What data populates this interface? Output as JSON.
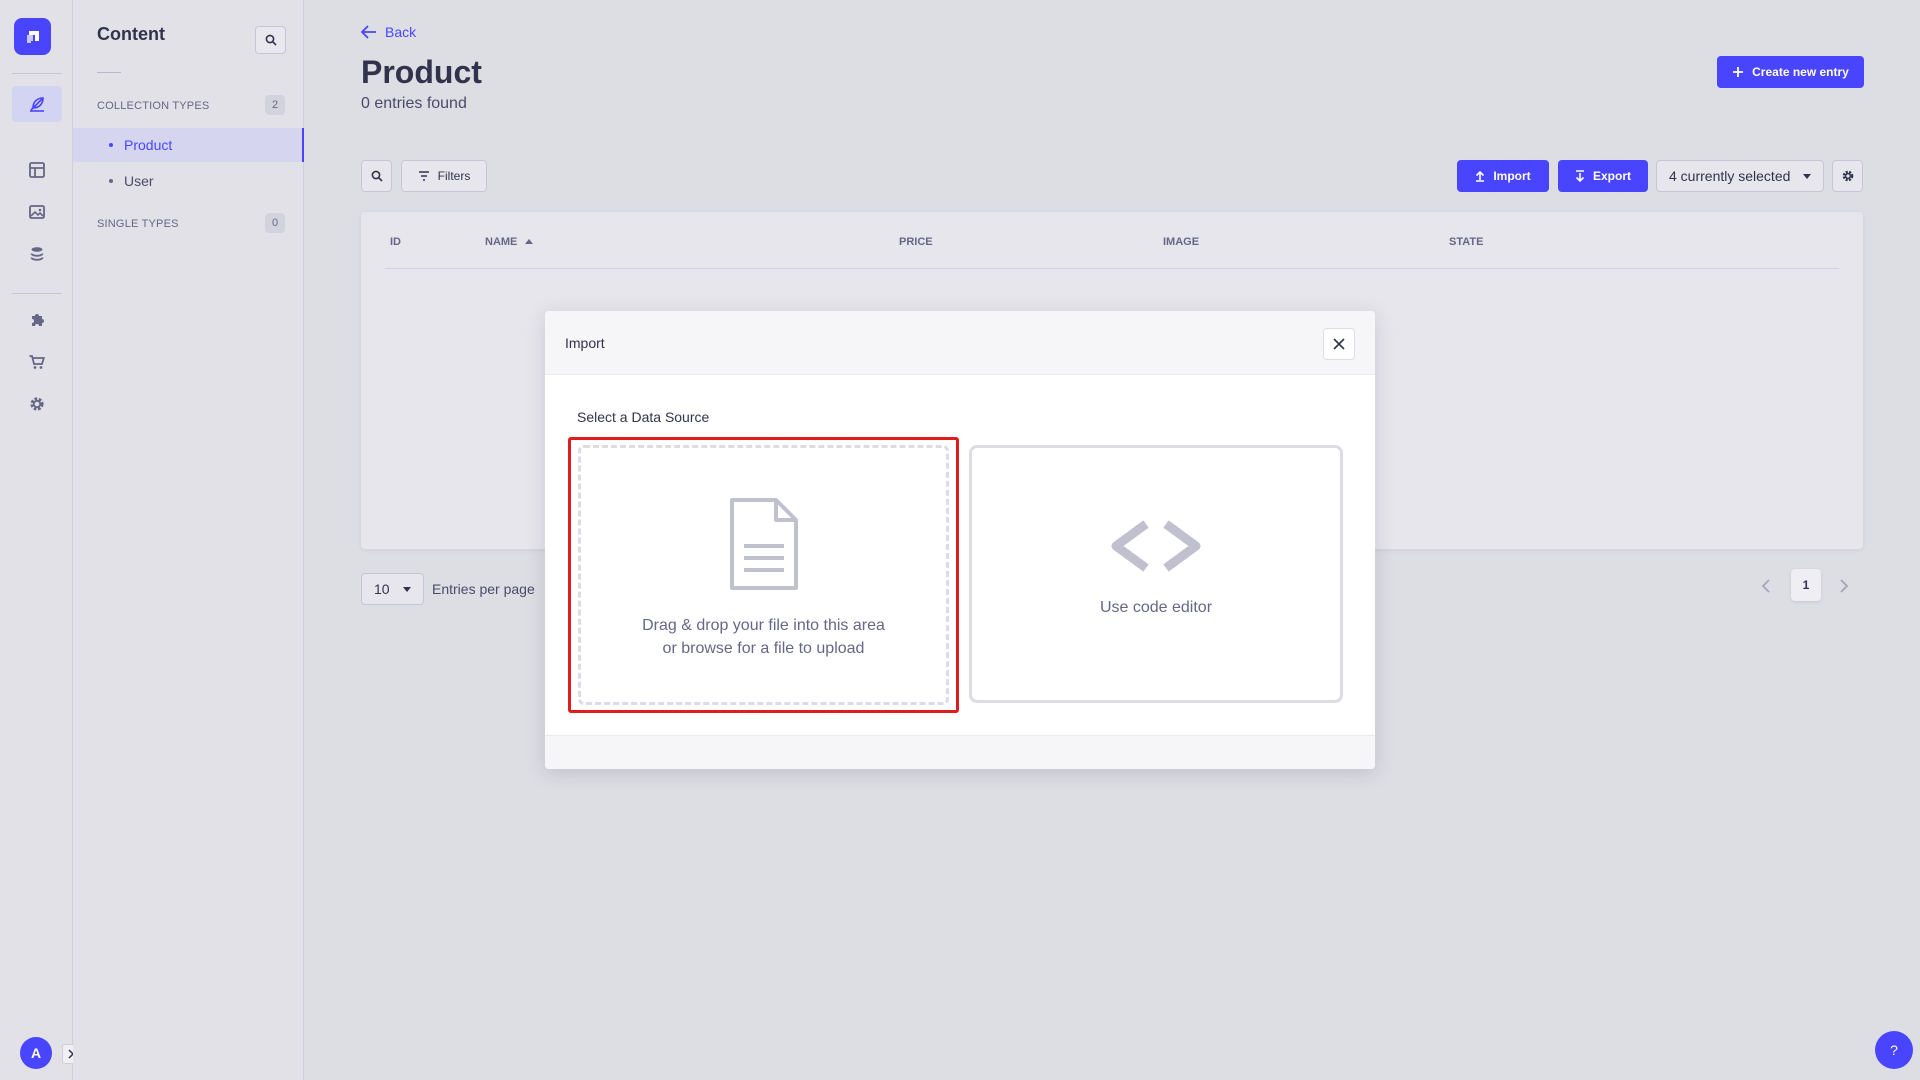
{
  "sidebar": {
    "title": "Content",
    "collection_types_label": "COLLECTION TYPES",
    "collection_types_count": "2",
    "single_types_label": "SINGLE TYPES",
    "single_types_count": "0",
    "items": [
      {
        "label": "Product",
        "active": true
      },
      {
        "label": "User",
        "active": false
      }
    ],
    "avatar_initial": "A"
  },
  "header": {
    "back_label": "Back",
    "title": "Product",
    "subtitle": "0 entries found",
    "create_label": "Create new entry"
  },
  "toolbar": {
    "filters_label": "Filters",
    "import_label": "Import",
    "export_label": "Export",
    "columns_select": "4 currently selected"
  },
  "table": {
    "columns": [
      "ID",
      "NAME",
      "PRICE",
      "IMAGE",
      "STATE"
    ]
  },
  "pagination": {
    "per_page": "10",
    "per_page_label": "Entries per page",
    "current_page": "1"
  },
  "help_label": "?",
  "modal": {
    "title": "Import",
    "section_label": "Select a Data Source",
    "dropzone_line1": "Drag & drop your file into this area",
    "dropzone_line2": "or browse for a file to upload",
    "code_editor_label": "Use code editor"
  },
  "colors": {
    "primary": "#4945ff",
    "highlight": "#e11c1c"
  }
}
